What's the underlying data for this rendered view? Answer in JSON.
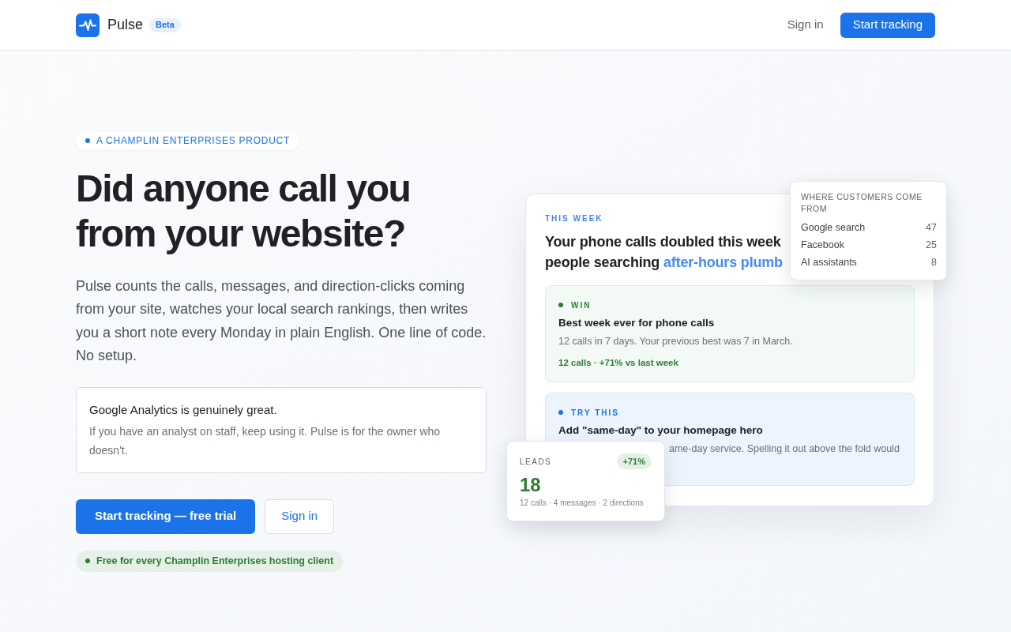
{
  "header": {
    "logo": {
      "name": "Pulse",
      "badge": "Beta"
    },
    "nav": [
      {
        "label": "Sign in",
        "kind": "link"
      },
      {
        "label": "Start tracking",
        "kind": "primary"
      }
    ]
  },
  "hero": {
    "eyebrow": "A CHAMPLIN ENTERPRISES PRODUCT",
    "headline_lines": [
      "Did anyone call you",
      "from your website?"
    ],
    "description": "Pulse counts the calls, messages, and direction-clicks coming from your site, watches your local search rankings, then writes you a short note every Monday in plain English. One line of code. No setup.",
    "note": {
      "title": "Google Analytics is genuinely great.",
      "body": "If you have an analyst on staff, keep using it. Pulse is for the owner who doesn't."
    },
    "actions": [
      {
        "label": "Start tracking — free trial",
        "kind": "primary"
      },
      {
        "label": "Sign in",
        "kind": "secondary"
      }
    ],
    "badge": "Free for every Champlin Enterprises hosting client"
  },
  "report_card": {
    "eyebrow": "THIS WEEK",
    "title_lines": [
      [
        {
          "text": "Your phone calls doubled this week",
          "highlight": false
        }
      ],
      [
        {
          "text": "people searching ",
          "highlight": false
        },
        {
          "text": "after-hours plumb",
          "highlight": true
        }
      ]
    ],
    "insights": [
      {
        "kind": "win",
        "label": "WIN",
        "title": "Best week ever for phone calls",
        "body": "12 calls in 7 days. Your previous best was 7 in March.",
        "stat": "12 calls · +71% vs last week"
      },
      {
        "kind": "try",
        "label": "TRY THIS",
        "title": "Add \"same-day\" to your homepage hero",
        "body": "ame-day service. Spelling it out above the fold would"
      }
    ]
  },
  "sources_card": {
    "title": "WHERE CUSTOMERS COME FROM",
    "rows": [
      {
        "label": "Google search",
        "value": "47"
      },
      {
        "label": "Facebook",
        "value": "25"
      },
      {
        "label": "AI assistants",
        "value": "8"
      }
    ]
  },
  "leads_card": {
    "label": "LEADS",
    "change": "+71%",
    "value": "18",
    "breakdown": "12 calls · 4 messages · 2 directions"
  }
}
